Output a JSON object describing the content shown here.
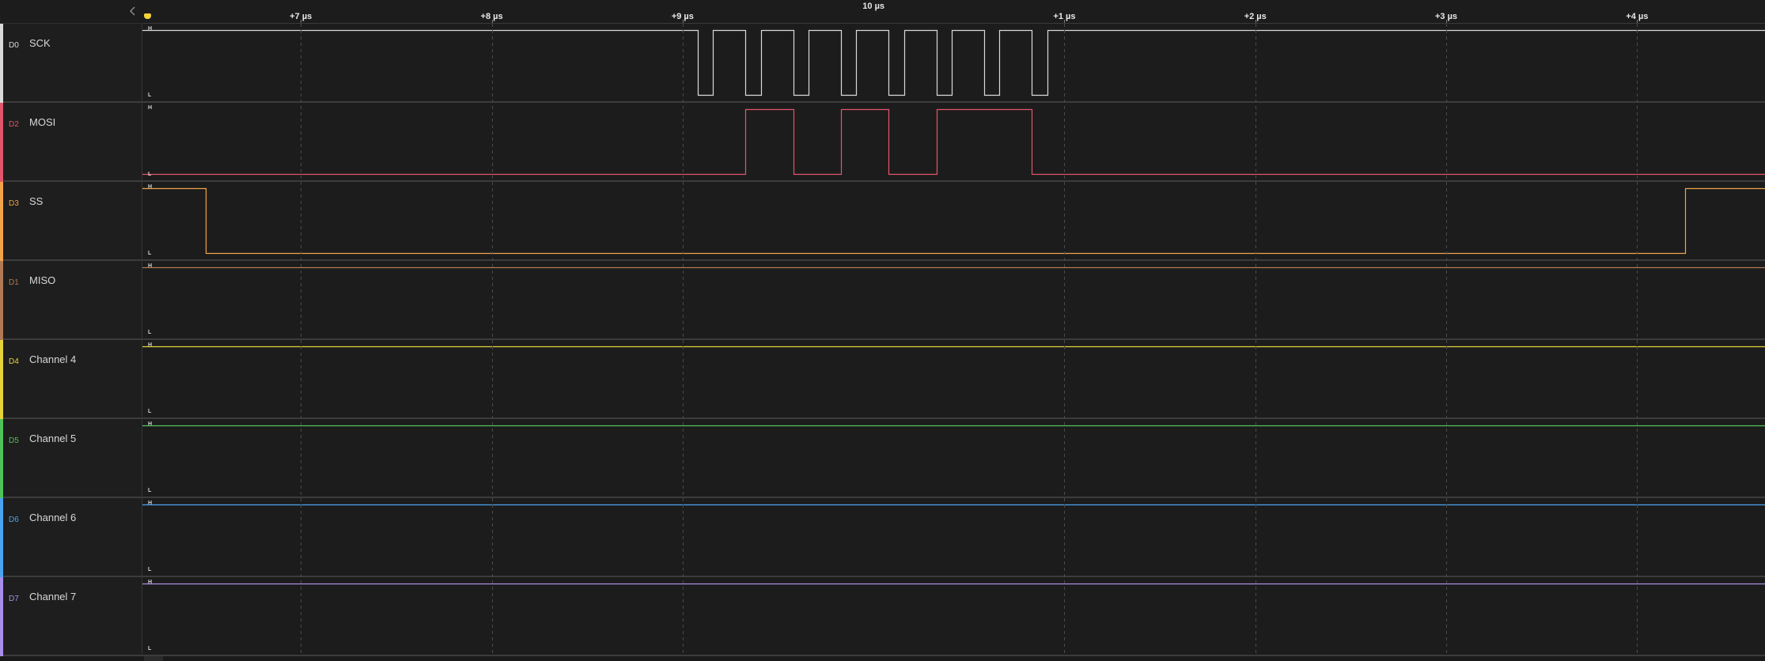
{
  "ruler": {
    "center_label": "10 µs",
    "ticks": [
      {
        "t": 7,
        "label": "+7 µs"
      },
      {
        "t": 8,
        "label": "+8 µs"
      },
      {
        "t": 9,
        "label": "+9 µs"
      },
      {
        "t": 11,
        "label": "+1 µs"
      },
      {
        "t": 12,
        "label": "+2 µs"
      },
      {
        "t": 13,
        "label": "+3 µs"
      },
      {
        "t": 14,
        "label": "+4 µs"
      }
    ]
  },
  "view": {
    "t_start": 6.17,
    "t_end": 14.67
  },
  "levels": {
    "high": "H",
    "low": "L"
  },
  "icons": {
    "collapse": "chevron-left-icon",
    "marker": "timing-marker-flag-icon"
  },
  "channels": [
    {
      "id": "D0",
      "name": "SCK",
      "color": "#d9d9d9",
      "id_color": "#d9d9d9",
      "initial": 1,
      "edges": [
        9.08,
        9.16,
        9.33,
        9.41,
        9.58,
        9.66,
        9.83,
        9.91,
        10.08,
        10.16,
        10.33,
        10.41,
        10.58,
        10.66,
        10.83,
        10.91
      ]
    },
    {
      "id": "D2",
      "name": "MOSI",
      "color": "#e0566b",
      "id_color": "#e0566b",
      "initial": 0,
      "edges": [
        9.33,
        9.58,
        9.83,
        10.08,
        10.33,
        10.83
      ]
    },
    {
      "id": "D3",
      "name": "SS",
      "color": "#f0a347",
      "id_color": "#f0a347",
      "initial": 1,
      "edges": [
        6.5,
        14.25
      ]
    },
    {
      "id": "D1",
      "name": "MISO",
      "color": "#b07a55",
      "id_color": "#b07a55",
      "initial": 1,
      "edges": []
    },
    {
      "id": "D4",
      "name": "Channel 4",
      "color": "#e6d23a",
      "id_color": "#e6d23a",
      "initial": 1,
      "edges": []
    },
    {
      "id": "D5",
      "name": "Channel 5",
      "color": "#4fc35a",
      "id_color": "#4fc35a",
      "initial": 1,
      "edges": []
    },
    {
      "id": "D6",
      "name": "Channel 6",
      "color": "#4aa3f0",
      "id_color": "#4aa3f0",
      "initial": 1,
      "edges": []
    },
    {
      "id": "D7",
      "name": "Channel 7",
      "color": "#a98ee8",
      "id_color": "#a98ee8",
      "initial": 1,
      "edges": []
    }
  ]
}
